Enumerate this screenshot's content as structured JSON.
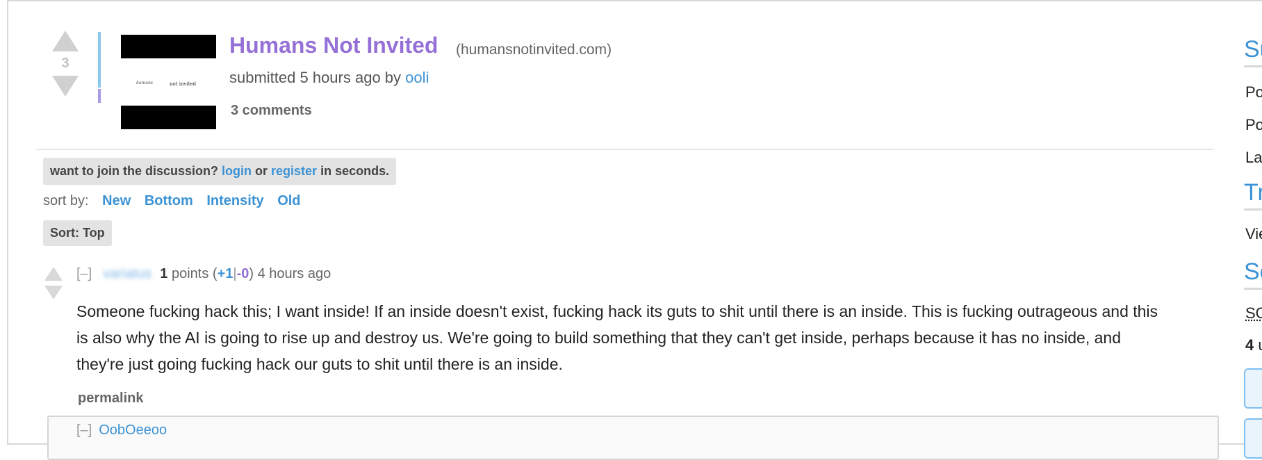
{
  "post": {
    "score": "3",
    "title": "Humans Not Invited",
    "domain": "(humansnotinvited.com)",
    "tagline_prefix": "submitted 5 hours ago by ",
    "author": "ooli",
    "comments": "3 comments",
    "thumbnail_text_1": "humans",
    "thumbnail_text_2": "not invited"
  },
  "discussion": {
    "join_prefix": "want to join the discussion? ",
    "login": "login",
    "or": " or ",
    "register": "register",
    "join_suffix": " in seconds.",
    "sort_by_label": "sort by:",
    "sort_options": [
      "New",
      "Bottom",
      "Intensity",
      "Old"
    ],
    "sort_current": "Sort: Top"
  },
  "comment": {
    "collapse": "[–]",
    "username": "variatus",
    "points": "1",
    "points_label": " points (",
    "plus": "+1",
    "minus": "-0",
    "time": ") 4 hours ago",
    "body": "Someone fucking hack this; I want inside! If an inside doesn't exist, fucking hack its guts to shit until there is an inside. This is fucking outrageous and this is also why the AI is going to rise up and destroy us. We're going to build something that they can't get inside, perhaps because it has no inside, and they're just going fucking hack our guts to shit until there is an inside.",
    "permalink": "permalink"
  },
  "child_peek": {
    "collapse": "[–]",
    "username": "OobOeeoo"
  },
  "sidebar": {
    "heading1": "Su",
    "line1": "Po",
    "line2": "Po",
    "line3": "La",
    "heading2": "Tr",
    "line4": "Vie",
    "heading3": "So",
    "line5": "SC",
    "line6_bold": "4",
    "line6_rest": " u"
  },
  "colors": {
    "link_blue": "#3b92d4",
    "title_purple": "#9570d6",
    "arrow_grey": "#d0d0d0"
  }
}
